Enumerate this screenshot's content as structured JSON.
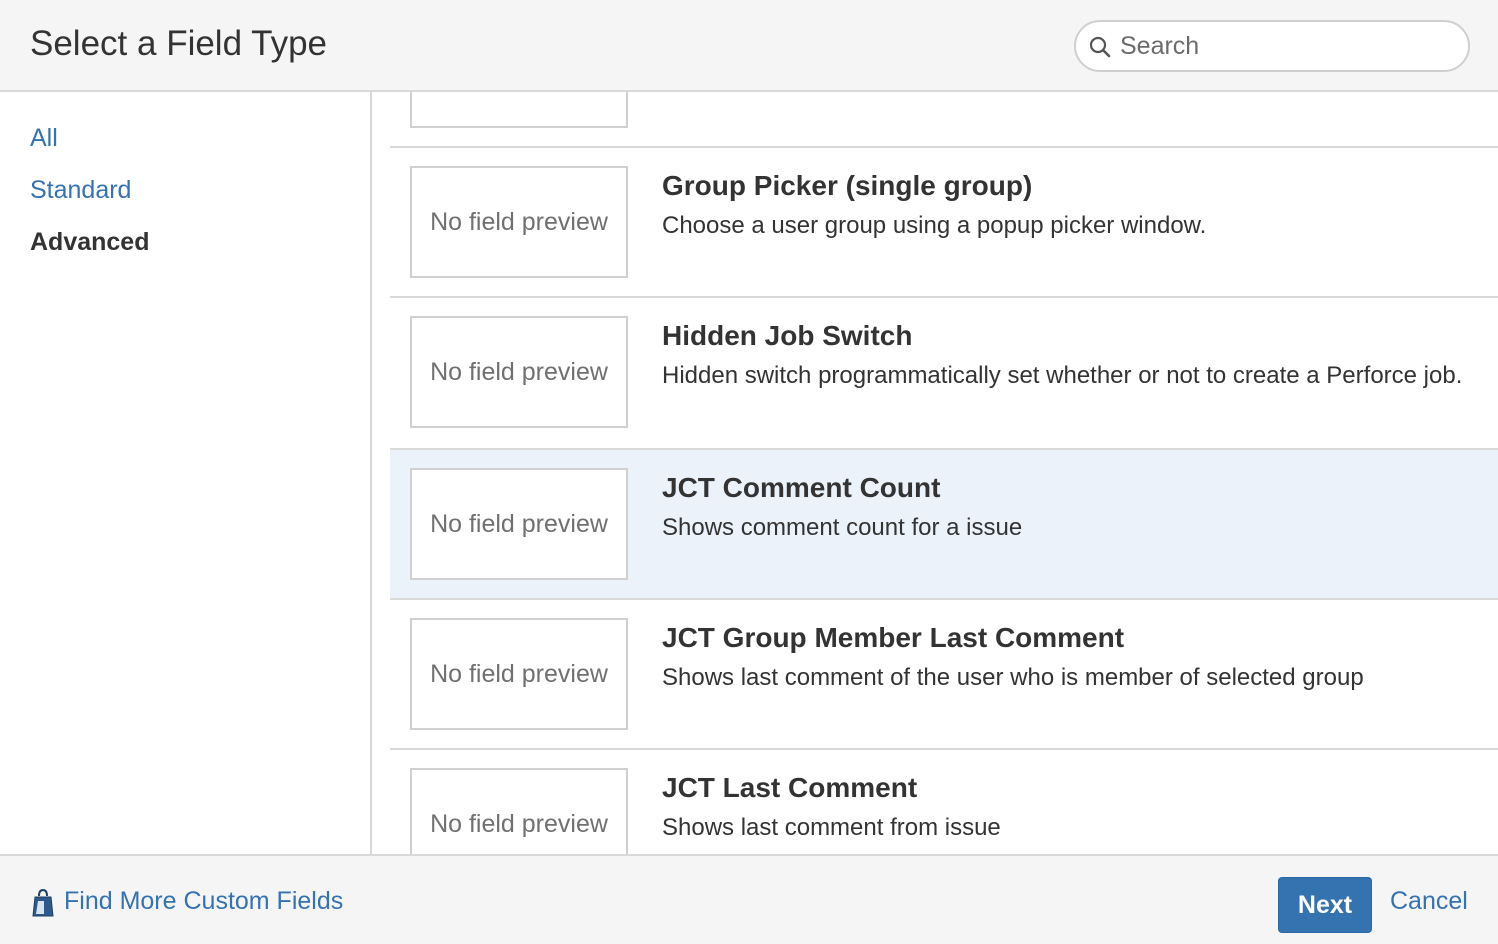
{
  "header": {
    "title": "Select a Field Type",
    "search_placeholder": "Search"
  },
  "sidebar": {
    "items": [
      {
        "label": "All",
        "active": false
      },
      {
        "label": "Standard",
        "active": false
      },
      {
        "label": "Advanced",
        "active": true
      }
    ]
  },
  "fields": [
    {
      "preview": "No field preview",
      "title": "Group Picker (single group)",
      "description": "Choose a user group using a popup picker window.",
      "selected": false
    },
    {
      "preview": "No field preview",
      "title": "Hidden Job Switch",
      "description": "Hidden switch programmatically set whether or not to create a Perforce job.",
      "selected": false
    },
    {
      "preview": "No field preview",
      "title": "JCT Comment Count",
      "description": "Shows comment count for a issue",
      "selected": true
    },
    {
      "preview": "No field preview",
      "title": "JCT Group Member Last Comment",
      "description": "Shows last comment of the user who is member of selected group",
      "selected": false
    },
    {
      "preview": "No field preview",
      "title": "JCT Last Comment",
      "description": "Shows last comment from issue",
      "selected": false
    }
  ],
  "footer": {
    "find_more_label": "Find More Custom Fields",
    "next_label": "Next",
    "cancel_label": "Cancel"
  },
  "colors": {
    "link": "#3572b0",
    "selected_row": "#ebf2fa",
    "primary_button": "#3572b0"
  },
  "icons": {
    "search": "search-icon",
    "plugin": "plugin-bag-icon"
  }
}
